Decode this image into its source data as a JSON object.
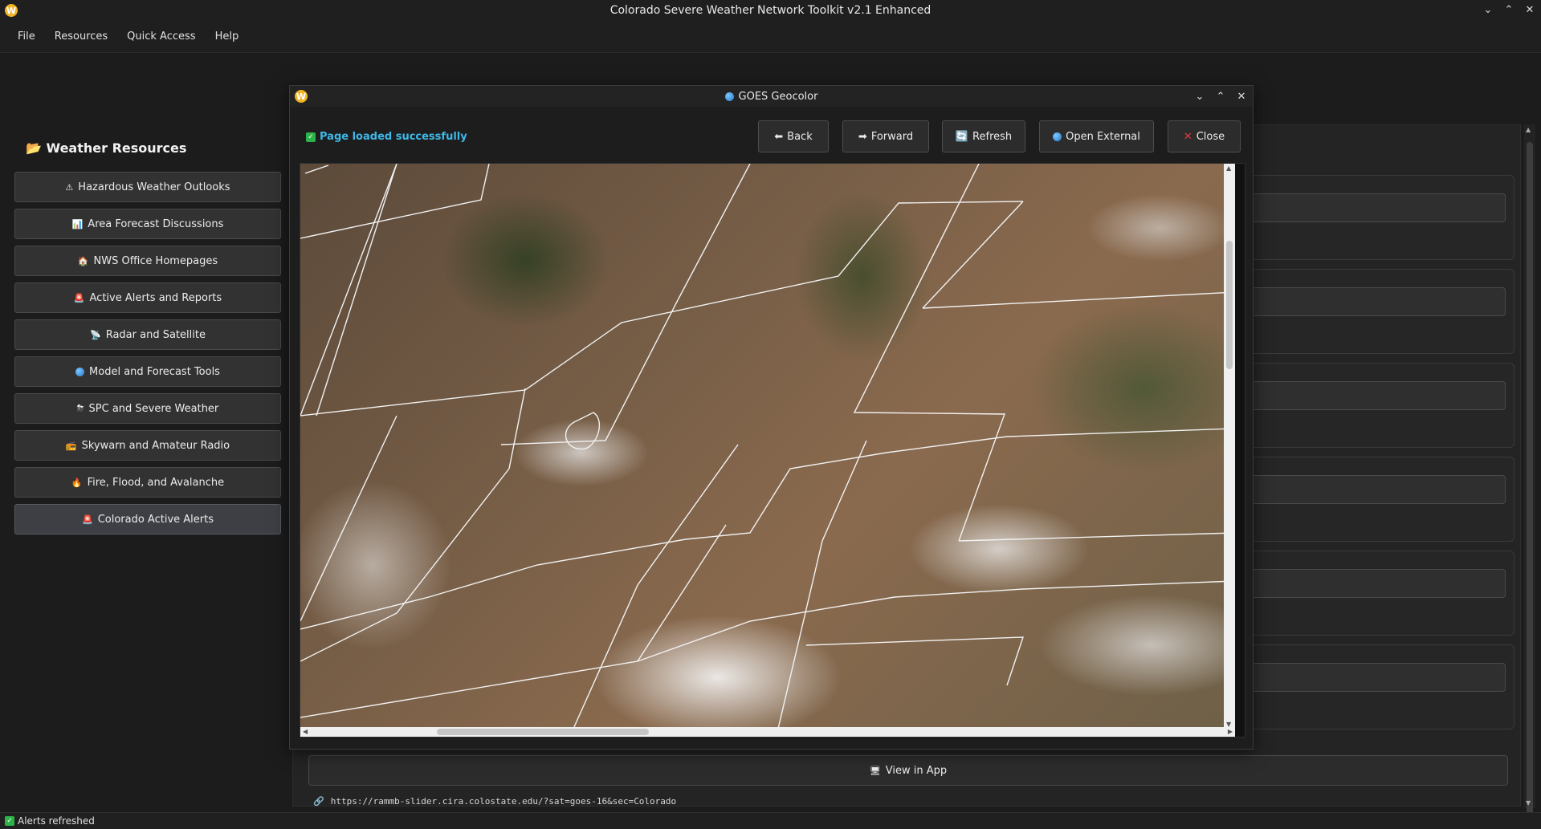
{
  "window": {
    "title": "Colorado Severe Weather Network Toolkit v2.1 Enhanced",
    "icon_letter": "W"
  },
  "menubar": {
    "items": [
      "File",
      "Resources",
      "Quick Access",
      "Help"
    ]
  },
  "sidebar": {
    "title": "Weather Resources",
    "title_icon": "folder-icon",
    "items": [
      {
        "label": "Hazardous Weather Outlooks",
        "icon": "warning-icon"
      },
      {
        "label": "Area Forecast Discussions",
        "icon": "chart-icon"
      },
      {
        "label": "NWS Office Homepages",
        "icon": "home-icon"
      },
      {
        "label": "Active Alerts and Reports",
        "icon": "siren-icon"
      },
      {
        "label": "Radar and Satellite",
        "icon": "satellite-icon"
      },
      {
        "label": "Model and Forecast Tools",
        "icon": "globe-icon"
      },
      {
        "label": "SPC and Severe Weather",
        "icon": "storm-icon"
      },
      {
        "label": "Skywarn and Amateur Radio",
        "icon": "radio-icon"
      },
      {
        "label": "Fire, Flood, and Avalanche",
        "icon": "fire-icon"
      },
      {
        "label": "Colorado Active Alerts",
        "icon": "siren-icon",
        "selected": true
      }
    ]
  },
  "main": {
    "view_in_app_label": "View in App",
    "url": "https://rammb-slider.cira.colostate.edu/?sat=goes-16&sec=Colorado"
  },
  "dialog": {
    "title": "GOES Geocolor",
    "status": "Page loaded successfully",
    "buttons": {
      "back": "Back",
      "forward": "Forward",
      "refresh": "Refresh",
      "open_external": "Open External",
      "close": "Close"
    }
  },
  "statusbar": {
    "message": "Alerts refreshed"
  },
  "colors": {
    "accent_status": "#3db8e8",
    "close_x": "#e83a3a",
    "check_green": "#2db24a"
  }
}
